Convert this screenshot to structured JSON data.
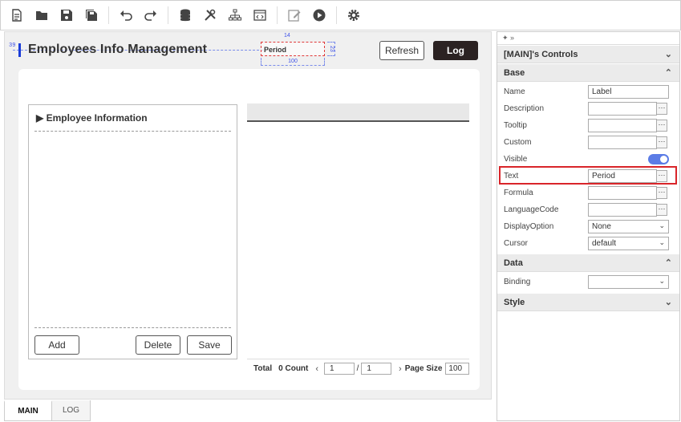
{
  "toolbar": {
    "icons": [
      "new-file-icon",
      "open-folder-icon",
      "save-icon",
      "save-all-icon",
      "undo-icon",
      "redo-icon",
      "database-icon",
      "tools-icon",
      "hierarchy-icon",
      "code-window-icon",
      "edit-icon",
      "run-icon",
      "settings-icon"
    ]
  },
  "canvas": {
    "title_marker": "39",
    "page_title": "Employees Info Management",
    "selected_label": "Period",
    "dim_top": "14",
    "dim_right": "23",
    "dim_bottom": "100",
    "refresh_label": "Refresh",
    "log_label": "Log",
    "employee": {
      "title": "Employee Information",
      "add_label": "Add",
      "delete_label": "Delete",
      "save_label": "Save"
    },
    "grid_footer": {
      "total_label": "Total",
      "count_label": "0 Count",
      "prev_arrow": "‹",
      "current_page": "1",
      "slash": "/",
      "total_pages": "1",
      "next_arrow": "›",
      "page_size_label": "Page Size",
      "page_size_value": "100"
    }
  },
  "tabs": [
    {
      "label": "MAIN"
    },
    {
      "label": "LOG"
    }
  ],
  "properties": {
    "header_icons": "✦ »",
    "controls_title": "[MAIN]'s Controls",
    "base_title": "Base",
    "data_title": "Data",
    "style_title": "Style",
    "rows": {
      "name": {
        "label": "Name",
        "value": "Label"
      },
      "description": {
        "label": "Description",
        "value": ""
      },
      "tooltip": {
        "label": "Tooltip",
        "value": ""
      },
      "custom": {
        "label": "Custom",
        "value": ""
      },
      "visible": {
        "label": "Visible",
        "value": true
      },
      "text": {
        "label": "Text",
        "value": "Period"
      },
      "formula": {
        "label": "Formula",
        "value": ""
      },
      "languagecode": {
        "label": "LanguageCode",
        "value": ""
      },
      "displayoption": {
        "label": "DisplayOption",
        "value": "None"
      },
      "cursor": {
        "label": "Cursor",
        "value": "default"
      },
      "binding": {
        "label": "Binding",
        "value": ""
      }
    },
    "dots": "···"
  },
  "colors": {
    "accent": "#1a3cd8",
    "log_button": "#2b2222",
    "highlight": "#d9252a",
    "toggle": "#5b7ce6"
  }
}
